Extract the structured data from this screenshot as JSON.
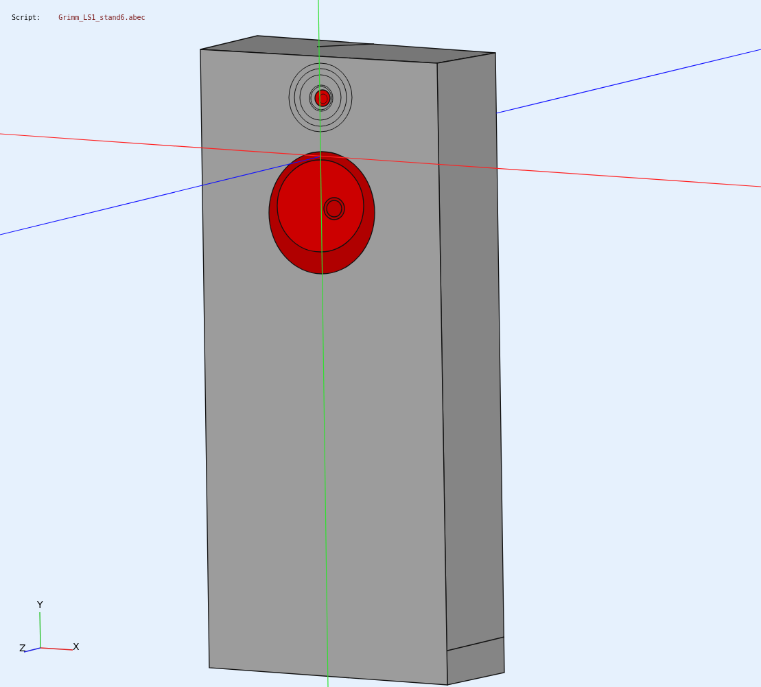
{
  "script_info": {
    "label": "Script:",
    "filename": "Grimm_LS1_stand6.abec"
  },
  "axis_gizmo": {
    "y_label": "Y",
    "x_label": "X",
    "z_label": "Z"
  }
}
